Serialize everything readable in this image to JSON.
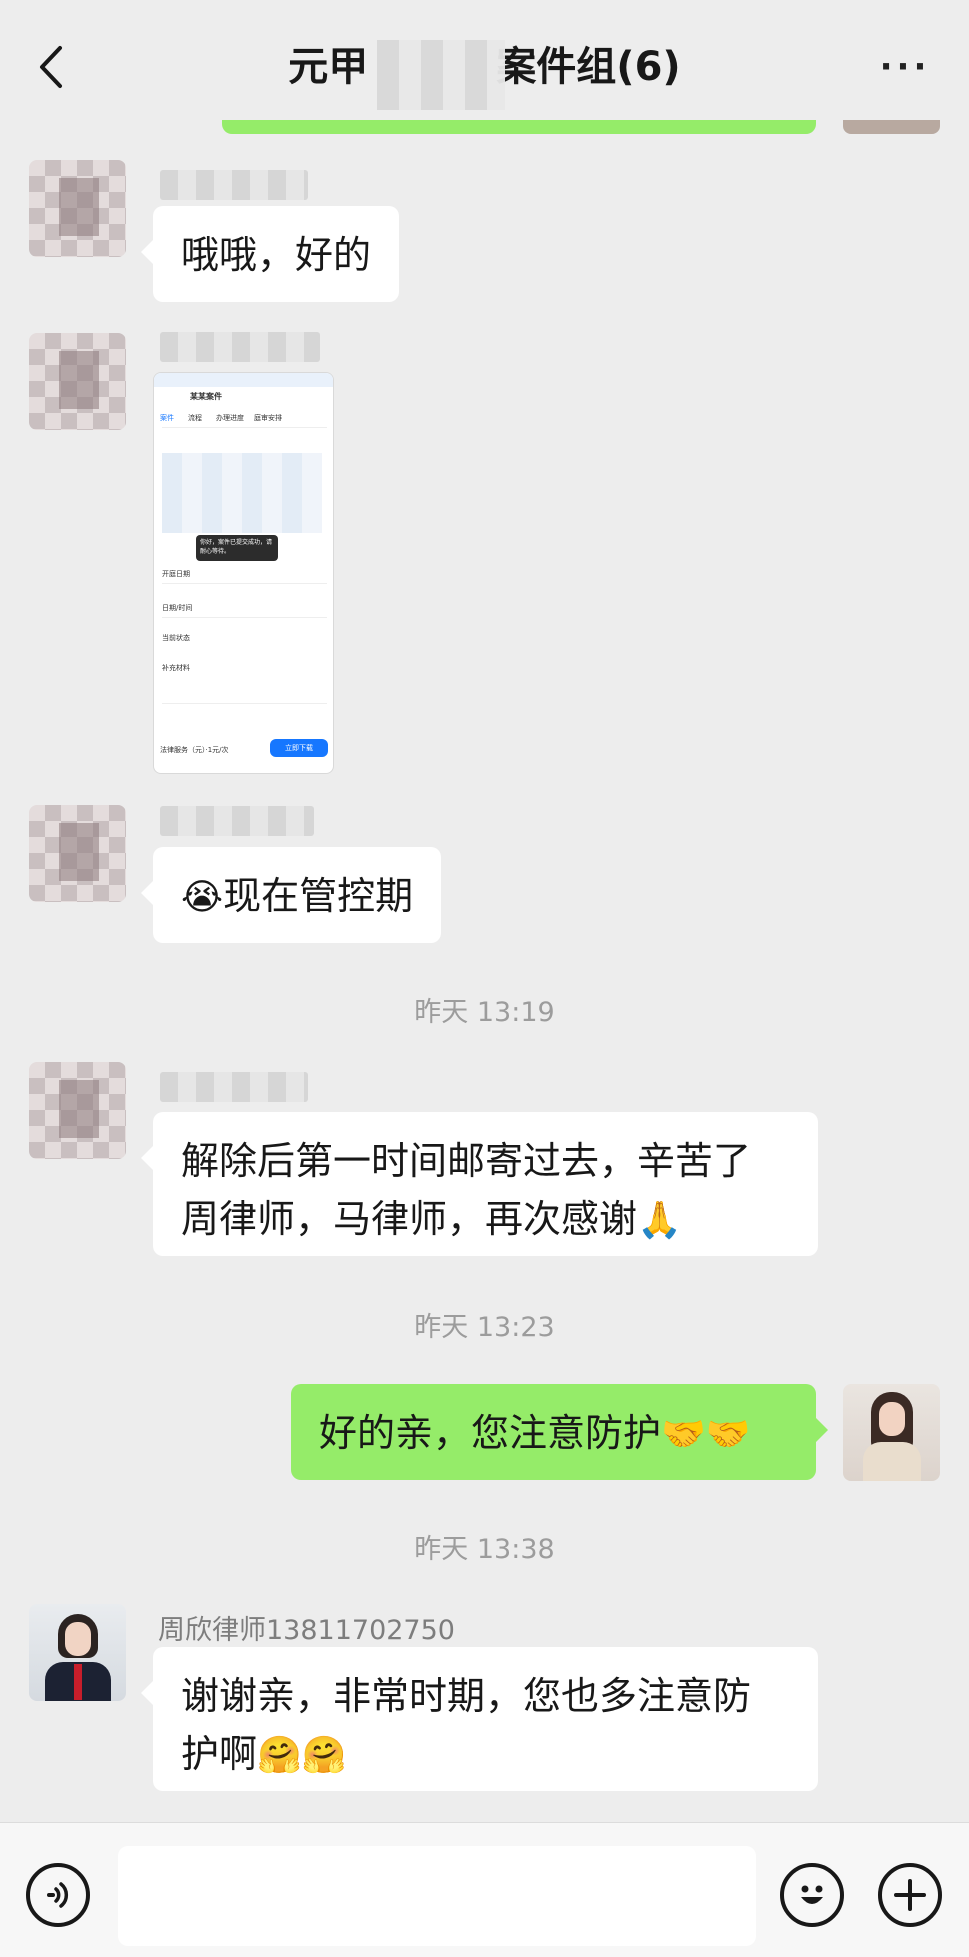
{
  "header": {
    "title": "元甲____案件组(6)",
    "title_visible": "元甲",
    "title_suffix": "案件组(6)",
    "more_label": "···"
  },
  "messages": [
    {
      "type": "text",
      "side": "left",
      "text": "哦哦，好的"
    },
    {
      "type": "image",
      "side": "left",
      "screenshot": {
        "app_title": "某某案件",
        "tabs": [
          "案件",
          "流程",
          "办理进度",
          "庭审安排"
        ],
        "tip_text": "你好，案件已提交成功，请耐心等待。",
        "rows": [
          "开庭日期",
          "日期/时间",
          "当前状态",
          "补充材料"
        ],
        "button": "立即下载",
        "footer_text": "法律服务（元）·1元/次"
      }
    },
    {
      "type": "text",
      "side": "left",
      "emoji": "😭",
      "text": "现在管控期"
    },
    {
      "type": "time",
      "text": "昨天 13:19"
    },
    {
      "type": "text",
      "side": "left",
      "line1": "解除后第一时间邮寄过去，辛苦了",
      "line2": "周律师，马律师，再次感谢",
      "emoji": "🙏"
    },
    {
      "type": "time",
      "text": "昨天 13:23"
    },
    {
      "type": "text",
      "side": "right",
      "text": "好的亲，您注意防护",
      "emoji": "🤝🤝"
    },
    {
      "type": "time",
      "text": "昨天 13:38"
    },
    {
      "type": "text",
      "side": "left",
      "sender": "周欣律师13811702750",
      "line1": "谢谢亲，非常时期，您也多注意防",
      "line2": "护啊",
      "emoji": "🤗🤗"
    }
  ],
  "icons": {
    "back": "chevron-left-icon",
    "more": "ellipsis-icon",
    "voice": "voice-icon",
    "emoji": "smiley-icon",
    "plus": "plus-icon"
  },
  "colors": {
    "background": "#ededed",
    "bubble_self": "#95ec69",
    "bubble_other": "#ffffff",
    "time_text": "#9c9c9c"
  }
}
